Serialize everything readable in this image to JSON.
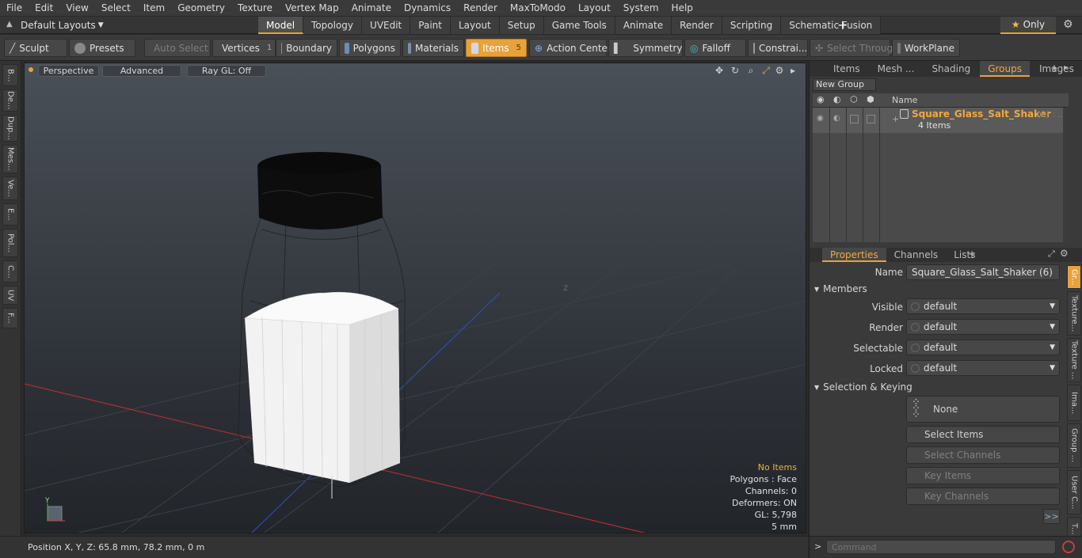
{
  "menu": [
    "File",
    "Edit",
    "View",
    "Select",
    "Item",
    "Geometry",
    "Texture",
    "Vertex Map",
    "Animate",
    "Dynamics",
    "Render",
    "MaxToModo",
    "Layout",
    "System",
    "Help"
  ],
  "layout_selector": "Default Layouts",
  "workspace_tabs": [
    "Model",
    "Topology",
    "UVEdit",
    "Paint",
    "Layout",
    "Setup",
    "Game Tools",
    "Animate",
    "Render",
    "Scripting",
    "Schematic Fusion"
  ],
  "active_workspace": "Model",
  "only_button": "Only",
  "toolbar": {
    "sculpt": "Sculpt",
    "presets": "Presets",
    "auto_select": "Auto Select",
    "vertices": "Vertices",
    "vertices_count": "1",
    "boundary": "Boundary",
    "polygons": "Polygons",
    "materials": "Materials",
    "items": "Items",
    "items_count": "5",
    "action_center": "Action Center",
    "symmetry": "Symmetry",
    "falloff": "Falloff",
    "constraints": "Constrai...",
    "select_through": "Select Through",
    "workplane": "WorkPlane"
  },
  "left_tabs": [
    "B...",
    "De...",
    "Dup...",
    "Mes...",
    "Ve...",
    "E...",
    "Pol...",
    "C...",
    "UV",
    "F..."
  ],
  "viewport": {
    "perspective": "Perspective",
    "advanced": "Advanced",
    "raygl": "Ray GL: Off",
    "stats": {
      "no_items": "No Items",
      "polygons": "Polygons : Face",
      "channels": "Channels: 0",
      "deformers": "Deformers: ON",
      "gl": "GL: 5,798",
      "unit": "5 mm"
    },
    "axis_y": "Y",
    "z_label": "Z"
  },
  "status_position": "Position X, Y, Z:  65.8 mm, 78.2 mm, 0 m",
  "right_tabs": [
    "Items",
    "Mesh ...",
    "Shading",
    "Groups",
    "Images"
  ],
  "active_right_tab": "Groups",
  "new_group": "New Group",
  "name_column": "Name",
  "group": {
    "name": "Square_Glass_Salt_Shaker",
    "count": "(6) : ...",
    "items": "4 Items"
  },
  "props_tabs": [
    "Properties",
    "Channels",
    "Lists"
  ],
  "props": {
    "name_label": "Name",
    "name_value": "Square_Glass_Salt_Shaker (6)",
    "members": "Members",
    "visible_label": "Visible",
    "visible_value": "default",
    "render_label": "Render",
    "render_value": "default",
    "selectable_label": "Selectable",
    "selectable_value": "default",
    "locked_label": "Locked",
    "locked_value": "default",
    "selection_keying": "Selection & Keying",
    "none": "None",
    "select_items": "Select Items",
    "select_channels": "Select Channels",
    "key_items": "Key Items",
    "key_channels": "Key Channels",
    "more": ">>"
  },
  "vertical_tabs": [
    "Gr...",
    "Texture...",
    "Texture ...",
    "Ima...",
    "Group ...",
    "User C...",
    "T..."
  ],
  "command_placeholder": "Command",
  "colors": {
    "accent": "#e8a23a",
    "x_axis": "#c03030",
    "z_axis": "#3050c0"
  }
}
